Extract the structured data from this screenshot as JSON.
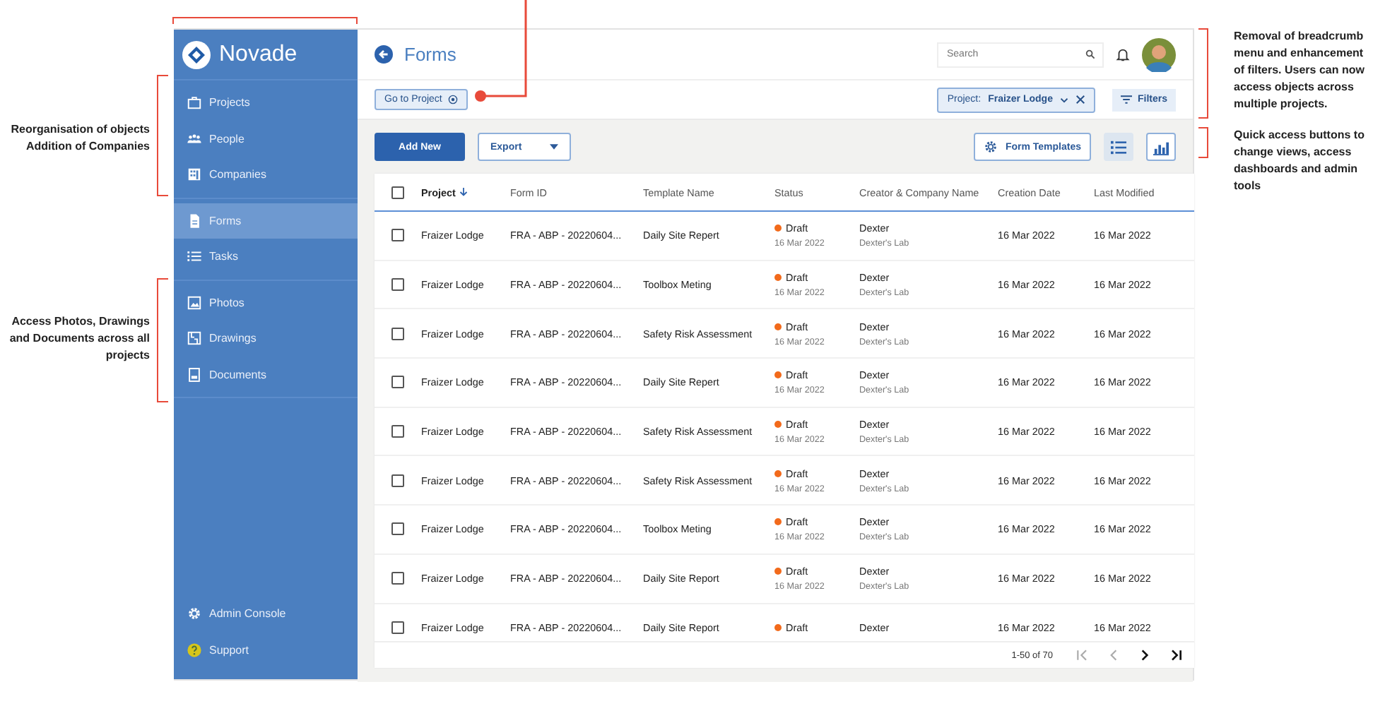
{
  "annotations": {
    "left": [
      "Reorganisation of objects Addition of Companies",
      "Access Photos, Drawings and Documents across all projects"
    ],
    "right": [
      "Removal of breadcrumb menu and enhancement of filters. Users can now access objects across multiple projects.",
      "Quick access buttons to change views, access dashboards and admin tools"
    ]
  },
  "sidebar": {
    "brand": "Novade",
    "groups": [
      [
        {
          "label": "Projects",
          "kind": "briefcase",
          "selected": false
        },
        {
          "label": "People",
          "kind": "people",
          "selected": false
        },
        {
          "label": "Companies",
          "kind": "building",
          "selected": false
        }
      ],
      [
        {
          "label": "Forms",
          "kind": "form",
          "selected": true
        },
        {
          "label": "Tasks",
          "kind": "list",
          "selected": false
        }
      ],
      [
        {
          "label": "Photos",
          "kind": "photo",
          "selected": false
        },
        {
          "label": "Drawings",
          "kind": "drawing",
          "selected": false
        },
        {
          "label": "Documents",
          "kind": "document",
          "selected": false
        }
      ]
    ],
    "bottom": [
      {
        "label": "Admin Console",
        "kind": "gear",
        "selected": false
      },
      {
        "label": "Support",
        "kind": "help",
        "selected": false
      }
    ]
  },
  "header": {
    "title": "Forms",
    "search": {
      "placeholder": "Search"
    }
  },
  "filter_bar": {
    "go_to_project": "Go to Project",
    "filter_chip": {
      "label": "Project:",
      "value": "Fraizer Lodge"
    },
    "filters_button": "Filters"
  },
  "toolbar": {
    "add_button": "Add New",
    "export_button": "Export",
    "templates_button": "Form Templates",
    "views": [
      {
        "kind": "list",
        "selected": true
      },
      {
        "kind": "chart",
        "selected": false
      }
    ]
  },
  "table": {
    "select_all_checked": false,
    "columns": [
      {
        "label": "Project",
        "sorted": true
      },
      {
        "label": "Form ID",
        "sorted": false
      },
      {
        "label": "Template Name",
        "sorted": false
      },
      {
        "label": "Status",
        "sorted": false
      },
      {
        "label": "Creator & Company Name",
        "sorted": false
      },
      {
        "label": "Creation Date",
        "sorted": false
      },
      {
        "label": "Last Modified",
        "sorted": false
      }
    ],
    "rows": [
      {
        "checked": false,
        "project": "Fraizer Lodge",
        "form_id": "FRA - ABP - 20220604...",
        "template": "Daily Site Repert",
        "status": {
          "label": "Draft",
          "color": "#f26a1b",
          "date": "16 Mar 2022"
        },
        "creator": {
          "name": "Dexter",
          "company": "Dexter's Lab"
        },
        "created": "16 Mar 2022",
        "modified": "16 Mar 2022"
      },
      {
        "checked": false,
        "project": "Fraizer Lodge",
        "form_id": "FRA - ABP - 20220604...",
        "template": "Toolbox Meting",
        "status": {
          "label": "Draft",
          "color": "#f26a1b",
          "date": "16 Mar 2022"
        },
        "creator": {
          "name": "Dexter",
          "company": "Dexter's Lab"
        },
        "created": "16 Mar 2022",
        "modified": "16 Mar 2022"
      },
      {
        "checked": false,
        "project": "Fraizer Lodge",
        "form_id": "FRA - ABP - 20220604...",
        "template": "Safety Risk Assessment",
        "status": {
          "label": "Draft",
          "color": "#f26a1b",
          "date": "16 Mar 2022"
        },
        "creator": {
          "name": "Dexter",
          "company": "Dexter's Lab"
        },
        "created": "16 Mar 2022",
        "modified": "16 Mar 2022"
      },
      {
        "checked": false,
        "project": "Fraizer Lodge",
        "form_id": "FRA - ABP - 20220604...",
        "template": "Daily Site Repert",
        "status": {
          "label": "Draft",
          "color": "#f26a1b",
          "date": "16 Mar 2022"
        },
        "creator": {
          "name": "Dexter",
          "company": "Dexter's Lab"
        },
        "created": "16 Mar 2022",
        "modified": "16 Mar 2022"
      },
      {
        "checked": false,
        "project": "Fraizer Lodge",
        "form_id": "FRA - ABP - 20220604...",
        "template": "Safety Risk Assessment",
        "status": {
          "label": "Draft",
          "color": "#f26a1b",
          "date": "16 Mar 2022"
        },
        "creator": {
          "name": "Dexter",
          "company": "Dexter's Lab"
        },
        "created": "16 Mar 2022",
        "modified": "16 Mar 2022"
      },
      {
        "checked": false,
        "project": "Fraizer Lodge",
        "form_id": "FRA - ABP - 20220604...",
        "template": "Safety Risk Assessment",
        "status": {
          "label": "Draft",
          "color": "#f26a1b",
          "date": "16 Mar 2022"
        },
        "creator": {
          "name": "Dexter",
          "company": "Dexter's Lab"
        },
        "created": "16 Mar 2022",
        "modified": "16 Mar 2022"
      },
      {
        "checked": false,
        "project": "Fraizer Lodge",
        "form_id": "FRA - ABP - 20220604...",
        "template": "Toolbox Meting",
        "status": {
          "label": "Draft",
          "color": "#f26a1b",
          "date": "16 Mar 2022"
        },
        "creator": {
          "name": "Dexter",
          "company": "Dexter's Lab"
        },
        "created": "16 Mar 2022",
        "modified": "16 Mar 2022"
      },
      {
        "checked": false,
        "project": "Fraizer Lodge",
        "form_id": "FRA - ABP - 20220604...",
        "template": "Daily Site Report",
        "status": {
          "label": "Draft",
          "color": "#f26a1b",
          "date": "16 Mar 2022"
        },
        "creator": {
          "name": "Dexter",
          "company": "Dexter's Lab"
        },
        "created": "16 Mar 2022",
        "modified": "16 Mar 2022"
      },
      {
        "checked": false,
        "project": "Fraizer Lodge",
        "form_id": "FRA - ABP - 20220604...",
        "template": "Daily Site Report",
        "status": {
          "label": "Draft",
          "color": "#f26a1b"
        },
        "creator": {
          "name": "Dexter"
        },
        "created": "16 Mar 2022",
        "modified": "16 Mar 2022"
      }
    ],
    "pagination": {
      "range": "1-50 of 70",
      "buttons": [
        {
          "kind": "first",
          "disabled": true
        },
        {
          "kind": "prev",
          "disabled": true
        },
        {
          "kind": "next",
          "disabled": false
        },
        {
          "kind": "last",
          "disabled": false
        }
      ]
    }
  }
}
